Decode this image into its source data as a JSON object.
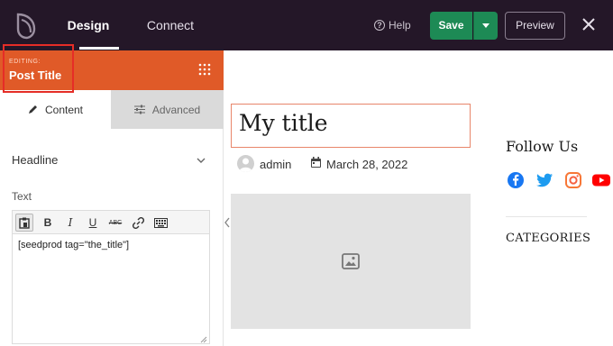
{
  "topbar": {
    "tabs": [
      "Design",
      "Connect"
    ],
    "help_label": "Help",
    "save_label": "Save",
    "preview_label": "Preview",
    "brand_color": "#241728",
    "save_color": "#1d8a55"
  },
  "panel": {
    "editing_label": "EDITING:",
    "block_title": "Post Title",
    "header_color": "#e05a28",
    "tabs": {
      "content": "Content",
      "advanced": "Advanced"
    },
    "section_title": "Headline",
    "field_label": "Text",
    "toolbar_icons": [
      "paste-icon",
      "bold-icon",
      "italic-icon",
      "underline-icon",
      "strikethrough-icon",
      "link-icon",
      "keyboard-icon"
    ],
    "toolbar_text": {
      "bold": "B",
      "italic": "I",
      "underline": "U",
      "strike": "ABC"
    },
    "editor_value": "[seedprod tag=\"the_title\"]"
  },
  "canvas": {
    "post_title": "My title",
    "author": "admin",
    "date": "March 28, 2022",
    "follow_title": "Follow Us",
    "social_icons": [
      "facebook-icon",
      "twitter-icon",
      "instagram-icon",
      "youtube-icon"
    ],
    "categories_title": "CATEGORIES"
  }
}
